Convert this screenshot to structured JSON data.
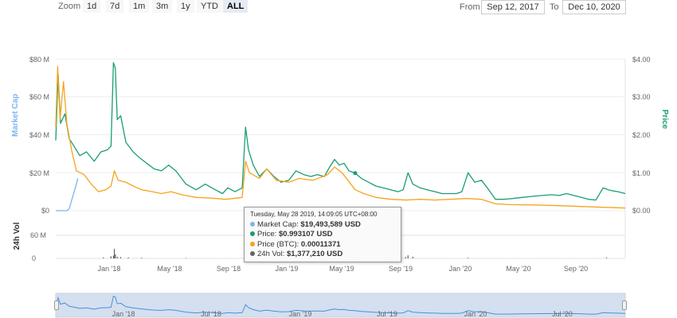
{
  "toolbar": {
    "zoom_label": "Zoom",
    "zoom_buttons": [
      "1d",
      "7d",
      "1m",
      "3m",
      "1y",
      "YTD",
      "ALL"
    ],
    "active_button": "ALL",
    "from_label": "From",
    "from_value": "Sep 12, 2017",
    "to_label": "To",
    "to_value": "Dec 10, 2020"
  },
  "chart_data": {
    "type": "line",
    "x_unit": "date",
    "x_range": [
      "2017-09-12",
      "2020-12-10"
    ],
    "x_ticks": [
      "Jan '18",
      "May '18",
      "Sep '18",
      "Jan '19",
      "May '19",
      "Sep '19",
      "Jan '20",
      "May '20",
      "Sep '20"
    ],
    "left_axis": {
      "title": "Market Cap",
      "ticks": [
        "$0",
        "$20 M",
        "$40 M",
        "$60 M",
        "$80 M"
      ],
      "range": [
        0,
        80000000
      ]
    },
    "right_axis": {
      "title": "Price",
      "ticks": [
        "$0.00",
        "$1.00",
        "$2.00",
        "$3.00",
        "$4.00"
      ],
      "range": [
        0,
        4
      ]
    },
    "volume_axis": {
      "title": "24h Vol",
      "ticks": [
        "0",
        "60 M"
      ],
      "range": [
        0,
        100000000
      ]
    },
    "navigator_ticks": [
      "Jan '18",
      "Jul '18",
      "Jan '19",
      "Jul '19",
      "Jan '20",
      "Jul '20"
    ],
    "colors": {
      "market_cap": "#7cb5ec",
      "price_usd": "#1a9d76",
      "price_btc": "#f7a31c",
      "volume": "#666666",
      "navigator": "#c8d7ee"
    },
    "series": [
      {
        "name": "Price",
        "axis": "right",
        "points": [
          [
            "2017-09-12",
            1.85
          ],
          [
            "2017-09-17",
            3.6
          ],
          [
            "2017-09-22",
            2.3
          ],
          [
            "2017-10-01",
            2.55
          ],
          [
            "2017-10-10",
            1.9
          ],
          [
            "2017-10-20",
            1.7
          ],
          [
            "2017-11-01",
            1.45
          ],
          [
            "2017-11-15",
            1.55
          ],
          [
            "2017-12-01",
            1.3
          ],
          [
            "2017-12-15",
            1.55
          ],
          [
            "2017-12-28",
            1.6
          ],
          [
            "2018-01-05",
            1.7
          ],
          [
            "2018-01-10",
            3.9
          ],
          [
            "2018-01-14",
            3.75
          ],
          [
            "2018-01-18",
            2.4
          ],
          [
            "2018-01-25",
            2.5
          ],
          [
            "2018-02-05",
            1.8
          ],
          [
            "2018-02-20",
            1.55
          ],
          [
            "2018-03-05",
            1.4
          ],
          [
            "2018-03-20",
            1.25
          ],
          [
            "2018-04-05",
            1.1
          ],
          [
            "2018-04-20",
            1.05
          ],
          [
            "2018-05-05",
            1.2
          ],
          [
            "2018-05-20",
            1.05
          ],
          [
            "2018-06-10",
            0.7
          ],
          [
            "2018-07-01",
            0.55
          ],
          [
            "2018-07-20",
            0.7
          ],
          [
            "2018-08-10",
            0.55
          ],
          [
            "2018-08-25",
            0.45
          ],
          [
            "2018-09-05",
            0.6
          ],
          [
            "2018-09-20",
            0.5
          ],
          [
            "2018-10-05",
            0.6
          ],
          [
            "2018-10-12",
            2.2
          ],
          [
            "2018-10-18",
            1.6
          ],
          [
            "2018-10-28",
            1.2
          ],
          [
            "2018-11-10",
            0.9
          ],
          [
            "2018-11-25",
            1.1
          ],
          [
            "2018-12-10",
            0.9
          ],
          [
            "2018-12-25",
            0.75
          ],
          [
            "2019-01-10",
            0.8
          ],
          [
            "2019-01-25",
            1.05
          ],
          [
            "2019-02-10",
            0.95
          ],
          [
            "2019-02-25",
            0.9
          ],
          [
            "2019-03-10",
            0.95
          ],
          [
            "2019-03-25",
            0.9
          ],
          [
            "2019-04-05",
            1.15
          ],
          [
            "2019-04-15",
            1.35
          ],
          [
            "2019-04-25",
            1.2
          ],
          [
            "2019-05-05",
            1.25
          ],
          [
            "2019-05-15",
            1.05
          ],
          [
            "2019-05-28",
            0.99
          ],
          [
            "2019-06-10",
            0.85
          ],
          [
            "2019-06-25",
            0.75
          ],
          [
            "2019-07-10",
            0.65
          ],
          [
            "2019-07-25",
            0.6
          ],
          [
            "2019-08-10",
            0.55
          ],
          [
            "2019-08-25",
            0.5
          ],
          [
            "2019-09-05",
            0.55
          ],
          [
            "2019-09-15",
            1.0
          ],
          [
            "2019-09-25",
            0.7
          ],
          [
            "2019-10-10",
            0.6
          ],
          [
            "2019-10-25",
            0.55
          ],
          [
            "2019-11-10",
            0.5
          ],
          [
            "2019-11-25",
            0.45
          ],
          [
            "2019-12-10",
            0.45
          ],
          [
            "2019-12-25",
            0.45
          ],
          [
            "2020-01-05",
            0.5
          ],
          [
            "2020-01-18",
            1.0
          ],
          [
            "2020-02-01",
            0.75
          ],
          [
            "2020-02-15",
            0.8
          ],
          [
            "2020-03-01",
            0.55
          ],
          [
            "2020-03-15",
            0.3
          ],
          [
            "2020-04-01",
            0.3
          ],
          [
            "2020-04-20",
            0.32
          ],
          [
            "2020-05-10",
            0.35
          ],
          [
            "2020-06-01",
            0.38
          ],
          [
            "2020-06-20",
            0.4
          ],
          [
            "2020-07-10",
            0.42
          ],
          [
            "2020-07-25",
            0.4
          ],
          [
            "2020-08-10",
            0.45
          ],
          [
            "2020-08-25",
            0.4
          ],
          [
            "2020-09-10",
            0.35
          ],
          [
            "2020-09-25",
            0.3
          ],
          [
            "2020-10-10",
            0.28
          ],
          [
            "2020-10-25",
            0.6
          ],
          [
            "2020-11-05",
            0.55
          ],
          [
            "2020-11-15",
            0.52
          ],
          [
            "2020-11-25",
            0.5
          ],
          [
            "2020-12-10",
            0.45
          ]
        ]
      },
      {
        "name": "Market Cap",
        "axis": "left",
        "points": [
          [
            "2017-09-12",
            0
          ],
          [
            "2017-10-05",
            0
          ],
          [
            "2017-10-10",
            1000000
          ],
          [
            "2017-10-18",
            8000000
          ],
          [
            "2017-10-24",
            13000000
          ],
          [
            "2017-10-28",
            17000000
          ]
        ]
      },
      {
        "name": "Price (BTC)",
        "axis": "right",
        "points": [
          [
            "2017-09-12",
            2.2
          ],
          [
            "2017-09-16",
            3.8
          ],
          [
            "2017-09-21",
            2.4
          ],
          [
            "2017-09-28",
            3.4
          ],
          [
            "2017-10-05",
            2.3
          ],
          [
            "2017-10-15",
            1.6
          ],
          [
            "2017-10-25",
            1.05
          ],
          [
            "2017-11-10",
            0.95
          ],
          [
            "2017-11-25",
            0.7
          ],
          [
            "2017-12-10",
            0.5
          ],
          [
            "2017-12-25",
            0.55
          ],
          [
            "2018-01-05",
            0.65
          ],
          [
            "2018-01-12",
            1.05
          ],
          [
            "2018-01-20",
            0.8
          ],
          [
            "2018-02-05",
            0.75
          ],
          [
            "2018-02-20",
            0.65
          ],
          [
            "2018-03-10",
            0.55
          ],
          [
            "2018-04-01",
            0.5
          ],
          [
            "2018-04-20",
            0.45
          ],
          [
            "2018-05-10",
            0.5
          ],
          [
            "2018-06-01",
            0.42
          ],
          [
            "2018-07-01",
            0.35
          ],
          [
            "2018-08-01",
            0.33
          ],
          [
            "2018-09-01",
            0.3
          ],
          [
            "2018-10-05",
            0.35
          ],
          [
            "2018-10-12",
            1.3
          ],
          [
            "2018-10-20",
            1.0
          ],
          [
            "2018-11-10",
            0.85
          ],
          [
            "2018-11-25",
            1.1
          ],
          [
            "2018-12-15",
            0.8
          ],
          [
            "2019-01-10",
            0.75
          ],
          [
            "2019-02-01",
            0.85
          ],
          [
            "2019-03-01",
            0.8
          ],
          [
            "2019-04-01",
            0.95
          ],
          [
            "2019-04-15",
            1.15
          ],
          [
            "2019-05-01",
            1.0
          ],
          [
            "2019-05-28",
            0.55
          ],
          [
            "2019-06-15",
            0.45
          ],
          [
            "2019-07-10",
            0.35
          ],
          [
            "2019-08-10",
            0.3
          ],
          [
            "2019-09-10",
            0.28
          ],
          [
            "2019-10-10",
            0.3
          ],
          [
            "2019-11-10",
            0.28
          ],
          [
            "2019-12-10",
            0.3
          ],
          [
            "2020-01-15",
            0.32
          ],
          [
            "2020-02-15",
            0.3
          ],
          [
            "2020-03-15",
            0.18
          ],
          [
            "2020-04-15",
            0.16
          ],
          [
            "2020-06-01",
            0.15
          ],
          [
            "2020-08-01",
            0.13
          ],
          [
            "2020-10-01",
            0.1
          ],
          [
            "2020-11-15",
            0.08
          ],
          [
            "2020-12-10",
            0.07
          ]
        ]
      },
      {
        "name": "24h Vol",
        "axis": "volume",
        "points": [
          [
            "2017-12-20",
            3000000
          ],
          [
            "2018-01-05",
            6000000
          ],
          [
            "2018-01-10",
            8000000
          ],
          [
            "2018-01-12",
            28000000
          ],
          [
            "2018-01-14",
            12000000
          ],
          [
            "2018-01-18",
            5000000
          ],
          [
            "2018-01-25",
            4000000
          ],
          [
            "2018-02-10",
            3000000
          ],
          [
            "2018-03-10",
            2000000
          ],
          [
            "2018-06-10",
            1000000
          ],
          [
            "2018-10-12",
            4000000
          ],
          [
            "2019-01-05",
            1500000
          ],
          [
            "2019-04-15",
            3000000
          ],
          [
            "2019-09-10",
            4000000
          ],
          [
            "2019-09-15",
            9000000
          ],
          [
            "2019-09-25",
            5000000
          ],
          [
            "2020-01-18",
            2000000
          ],
          [
            "2020-11-01",
            2500000
          ]
        ]
      }
    ]
  },
  "tooltip": {
    "date": "Tuesday, May 28 2019, 14:09:05 UTC+08:00",
    "rows": [
      {
        "label": "Market Cap:",
        "value": "$19,493,589 USD",
        "color": "#7cb5ec"
      },
      {
        "label": "Price:",
        "value": "$0.993107 USD",
        "color": "#1a9d76"
      },
      {
        "label": "Price (BTC):",
        "value": "0.00011371",
        "color": "#f7a31c"
      },
      {
        "label": "24h Vol:",
        "value": "$1,377,210 USD",
        "color": "#666666"
      }
    ]
  }
}
